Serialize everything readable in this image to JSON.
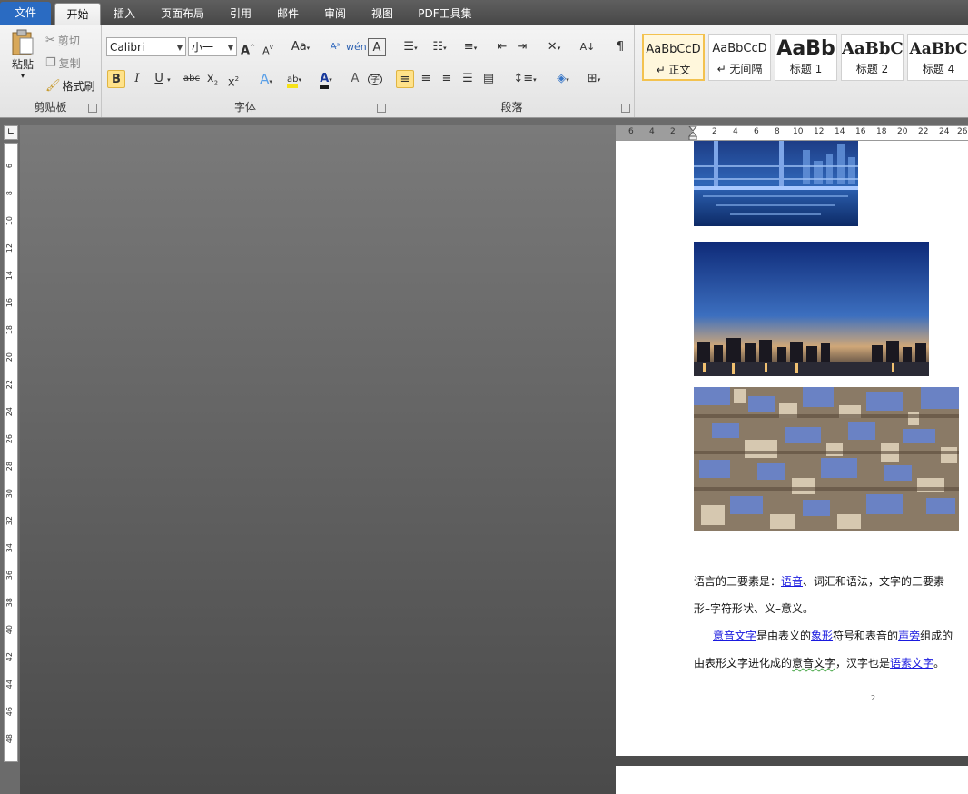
{
  "tabs": [
    "文件",
    "开始",
    "插入",
    "页面布局",
    "引用",
    "邮件",
    "审阅",
    "视图",
    "PDF工具集"
  ],
  "clipboard": {
    "paste": "粘贴",
    "cut": "剪切",
    "copy": "复制",
    "format_painter": "格式刷",
    "label": "剪贴板"
  },
  "font": {
    "family": "Calibri",
    "size": "小一",
    "label": "字体"
  },
  "paragraph": {
    "label": "段落"
  },
  "styles": [
    {
      "preview": "AaBbCcD",
      "name": "↵ 正文"
    },
    {
      "preview": "AaBbCcD",
      "name": "↵ 无间隔"
    },
    {
      "preview": "AaBb",
      "name": "标题 1"
    },
    {
      "preview": "AaBbC",
      "name": "标题 2"
    },
    {
      "preview": "AaBbC",
      "name": "标题 4"
    }
  ],
  "ruler_h": [
    "6",
    "4",
    "2",
    "",
    "2",
    "4",
    "6",
    "8",
    "10",
    "12",
    "14",
    "16",
    "18",
    "20",
    "22",
    "24",
    "26"
  ],
  "ruler_v": [
    "6",
    "8",
    "10",
    "12",
    "14",
    "16",
    "18",
    "20",
    "22",
    "24",
    "26",
    "28",
    "30",
    "32",
    "34",
    "36",
    "38",
    "40",
    "42",
    "44",
    "46",
    "48"
  ],
  "doc": {
    "line1": {
      "t1": "语言的三要素是：",
      "link1": "语音",
      "t2": "、词汇和语法，文字的三要素"
    },
    "line2": "形–字符形状、义–意义。",
    "line3": {
      "link1": "意音文字",
      "t1": "是由表义的",
      "link2": "象形",
      "t2": "符号和表音的",
      "link3": "声旁",
      "t3": "组成的"
    },
    "line4": {
      "t1": "由表形文字进化成的",
      "green": "意音文字",
      "t2": "，汉字也是",
      "link1": "语素文字",
      "t3": "。"
    },
    "page_number": "2"
  },
  "colors": {
    "file_tab": "#2a6bc2",
    "link": "#1a1adf",
    "selected_style": "#f3c24f"
  }
}
